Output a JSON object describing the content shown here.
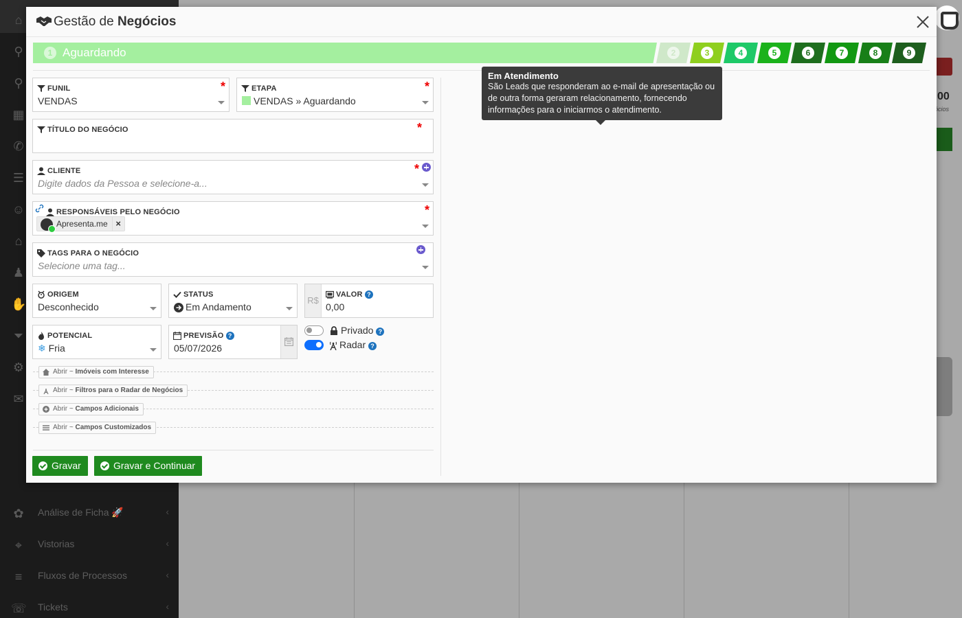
{
  "background": {
    "sidebar_items": [
      {
        "label": "",
        "icon": "home-icon"
      },
      {
        "label": "",
        "icon": "search-icon"
      },
      {
        "label": "",
        "icon": "search-icon"
      },
      {
        "label": "",
        "icon": "dashboard-icon"
      },
      {
        "label": "",
        "icon": "whatsapp-icon"
      },
      {
        "label": "",
        "icon": "contacts-icon"
      },
      {
        "label": "",
        "icon": "users-icon"
      },
      {
        "label": "",
        "icon": "house-icon"
      },
      {
        "label": "",
        "icon": "people-icon"
      },
      {
        "label": "",
        "icon": "handshake-icon"
      },
      {
        "label": "",
        "icon": "funnel-icon"
      },
      {
        "label": "",
        "icon": "gear-icon"
      },
      {
        "label": "",
        "icon": "megaphone-icon"
      },
      {
        "label": "Análise de Ficha 🚀",
        "icon": "analysis-icon"
      },
      {
        "label": "Vistorias",
        "icon": "location-icon"
      },
      {
        "label": "Fluxos de Processos",
        "icon": "flow-icon"
      },
      {
        "label": "Tickets",
        "icon": "support-icon"
      }
    ],
    "metric_value": "00",
    "metric_sub": "ócios"
  },
  "modal": {
    "title_prefix": "Gestão de ",
    "title_bold": "Negócios",
    "steps": [
      {
        "num": "1",
        "label": "Aguardando",
        "color": "#a4ef9f"
      },
      {
        "num": "2",
        "color": "#cfe8c9"
      },
      {
        "num": "3",
        "color": "#8fcf1f"
      },
      {
        "num": "4",
        "color": "#1ec968"
      },
      {
        "num": "5",
        "color": "#1bb21b"
      },
      {
        "num": "6",
        "color": "#1e6e1e"
      },
      {
        "num": "7",
        "color": "#129812"
      },
      {
        "num": "8",
        "color": "#187f18"
      },
      {
        "num": "9",
        "color": "#1d5e1d"
      }
    ],
    "tooltip": {
      "title": "Em Atendimento",
      "body": "São Leads que responderam ao e-mail de apresentação ou de outra forma geraram relacionamento, fornecendo informações para o iniciarmos o atendimento."
    },
    "fields": {
      "funil": {
        "label": "Funil",
        "value": "VENDAS"
      },
      "etapa": {
        "label": "Etapa",
        "value": "VENDAS » Aguardando",
        "swatch_color": "#a4ef9f"
      },
      "titulo": {
        "label": "Título do Negócio",
        "value": ""
      },
      "cliente": {
        "label": "Cliente",
        "placeholder": "Digite dados da Pessoa e selecione-a..."
      },
      "responsaveis": {
        "label": "Responsáveis pelo Negócio",
        "chip": "Apresenta.me",
        "remove": "×"
      },
      "tags": {
        "label": "Tags para o Negócio",
        "placeholder": "Selecione uma tag..."
      },
      "origem": {
        "label": "Origem",
        "value": "Desconhecido"
      },
      "status": {
        "label": "Status",
        "value": "Em Andamento"
      },
      "valor": {
        "label": "Valor",
        "prefix": "R$",
        "value": "0,00"
      },
      "potencial": {
        "label": "Potencial",
        "value": "Fria",
        "value_icon": "❄"
      },
      "previsao": {
        "label": "Previsão",
        "value": "05/07/2026"
      }
    },
    "toggles": {
      "privado": {
        "label": "Privado",
        "on": false
      },
      "radar": {
        "label": "Radar",
        "on": true
      }
    },
    "collapsibles": [
      {
        "prefix": "Abrir ~ ",
        "label": "Imóveis com Interesse",
        "icon": "house-icon"
      },
      {
        "prefix": "Abrir ~ ",
        "label": "Filtros para o Radar de Negócios",
        "icon": "radar-icon"
      },
      {
        "prefix": "Abrir ~ ",
        "label": "Campos Adicionais",
        "icon": "plus-circle-icon"
      },
      {
        "prefix": "Abrir ~ ",
        "label": "Campos Customizados",
        "icon": "list-icon"
      }
    ],
    "buttons": {
      "save": "Gravar",
      "save_continue": "Gravar e Continuar"
    },
    "help_glyph": "?",
    "required_glyph": "*",
    "colors": {
      "primary_green": "#1f8a1f",
      "required_red": "#ee0000",
      "help_blue": "#1e73be",
      "toggle_blue": "#0d6efd",
      "add_purple": "#6a5acd"
    }
  }
}
